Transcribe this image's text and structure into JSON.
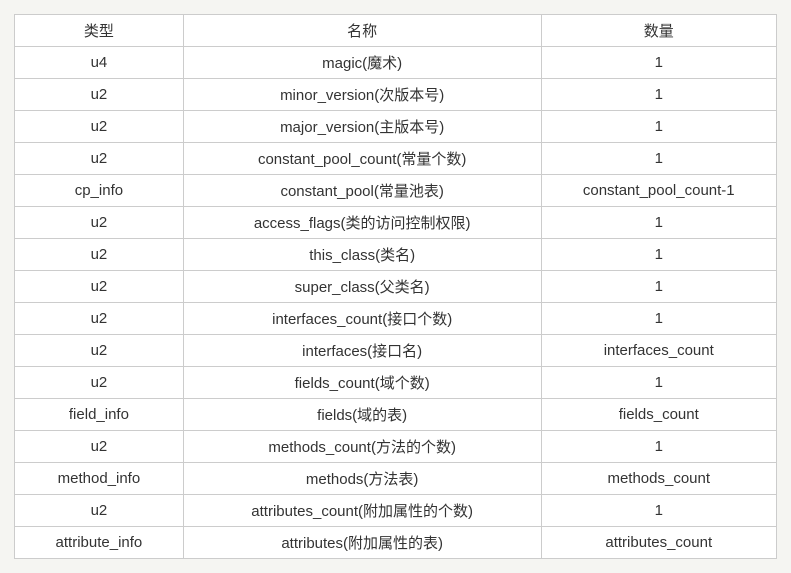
{
  "headers": {
    "type": "类型",
    "name": "名称",
    "quantity": "数量"
  },
  "rows": [
    {
      "type": "u4",
      "name": "magic(魔术)",
      "quantity": "1"
    },
    {
      "type": "u2",
      "name": "minor_version(次版本号)",
      "quantity": "1"
    },
    {
      "type": "u2",
      "name": "major_version(主版本号)",
      "quantity": "1"
    },
    {
      "type": "u2",
      "name": "constant_pool_count(常量个数)",
      "quantity": "1"
    },
    {
      "type": "cp_info",
      "name": "constant_pool(常量池表)",
      "quantity": "constant_pool_count-1"
    },
    {
      "type": "u2",
      "name": "access_flags(类的访问控制权限)",
      "quantity": "1"
    },
    {
      "type": "u2",
      "name": "this_class(类名)",
      "quantity": "1"
    },
    {
      "type": "u2",
      "name": "super_class(父类名)",
      "quantity": "1"
    },
    {
      "type": "u2",
      "name": "interfaces_count(接口个数)",
      "quantity": "1"
    },
    {
      "type": "u2",
      "name": "interfaces(接口名)",
      "quantity": "interfaces_count"
    },
    {
      "type": "u2",
      "name": "fields_count(域个数)",
      "quantity": "1"
    },
    {
      "type": "field_info",
      "name": "fields(域的表)",
      "quantity": "fields_count"
    },
    {
      "type": "u2",
      "name": "methods_count(方法的个数)",
      "quantity": "1"
    },
    {
      "type": "method_info",
      "name": "methods(方法表)",
      "quantity": "methods_count"
    },
    {
      "type": "u2",
      "name": "attributes_count(附加属性的个数)",
      "quantity": "1"
    },
    {
      "type": "attribute_info",
      "name": "attributes(附加属性的表)",
      "quantity": "attributes_count"
    }
  ]
}
